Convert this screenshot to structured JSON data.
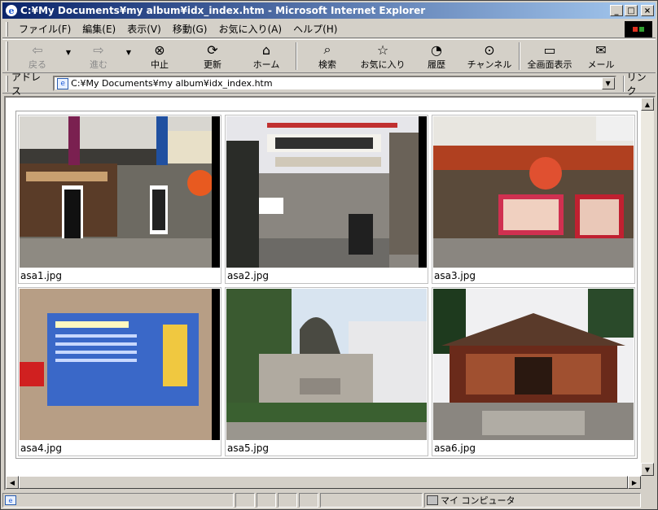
{
  "window": {
    "title": "C:¥My Documents¥my album¥idx_index.htm - Microsoft Internet Explorer"
  },
  "menu": [
    "ファイル(F)",
    "編集(E)",
    "表示(V)",
    "移動(G)",
    "お気に入り(A)",
    "ヘルプ(H)"
  ],
  "toolbar": {
    "back": "戻る",
    "forward": "進む",
    "stop": "中止",
    "refresh": "更新",
    "home": "ホーム",
    "search": "検索",
    "favorites": "お気に入り",
    "history": "履歴",
    "channels": "チャンネル",
    "fullscreen": "全画面表示",
    "mail": "メール"
  },
  "address": {
    "label": "アドレス",
    "value": "C:¥My Documents¥my album¥idx_index.htm",
    "links": "リンク"
  },
  "gallery": [
    {
      "caption": "asa1.jpg"
    },
    {
      "caption": "asa2.jpg"
    },
    {
      "caption": "asa3.jpg"
    },
    {
      "caption": "asa4.jpg"
    },
    {
      "caption": "asa5.jpg"
    },
    {
      "caption": "asa6.jpg"
    }
  ],
  "status": {
    "zone": "マイ コンピュータ"
  }
}
